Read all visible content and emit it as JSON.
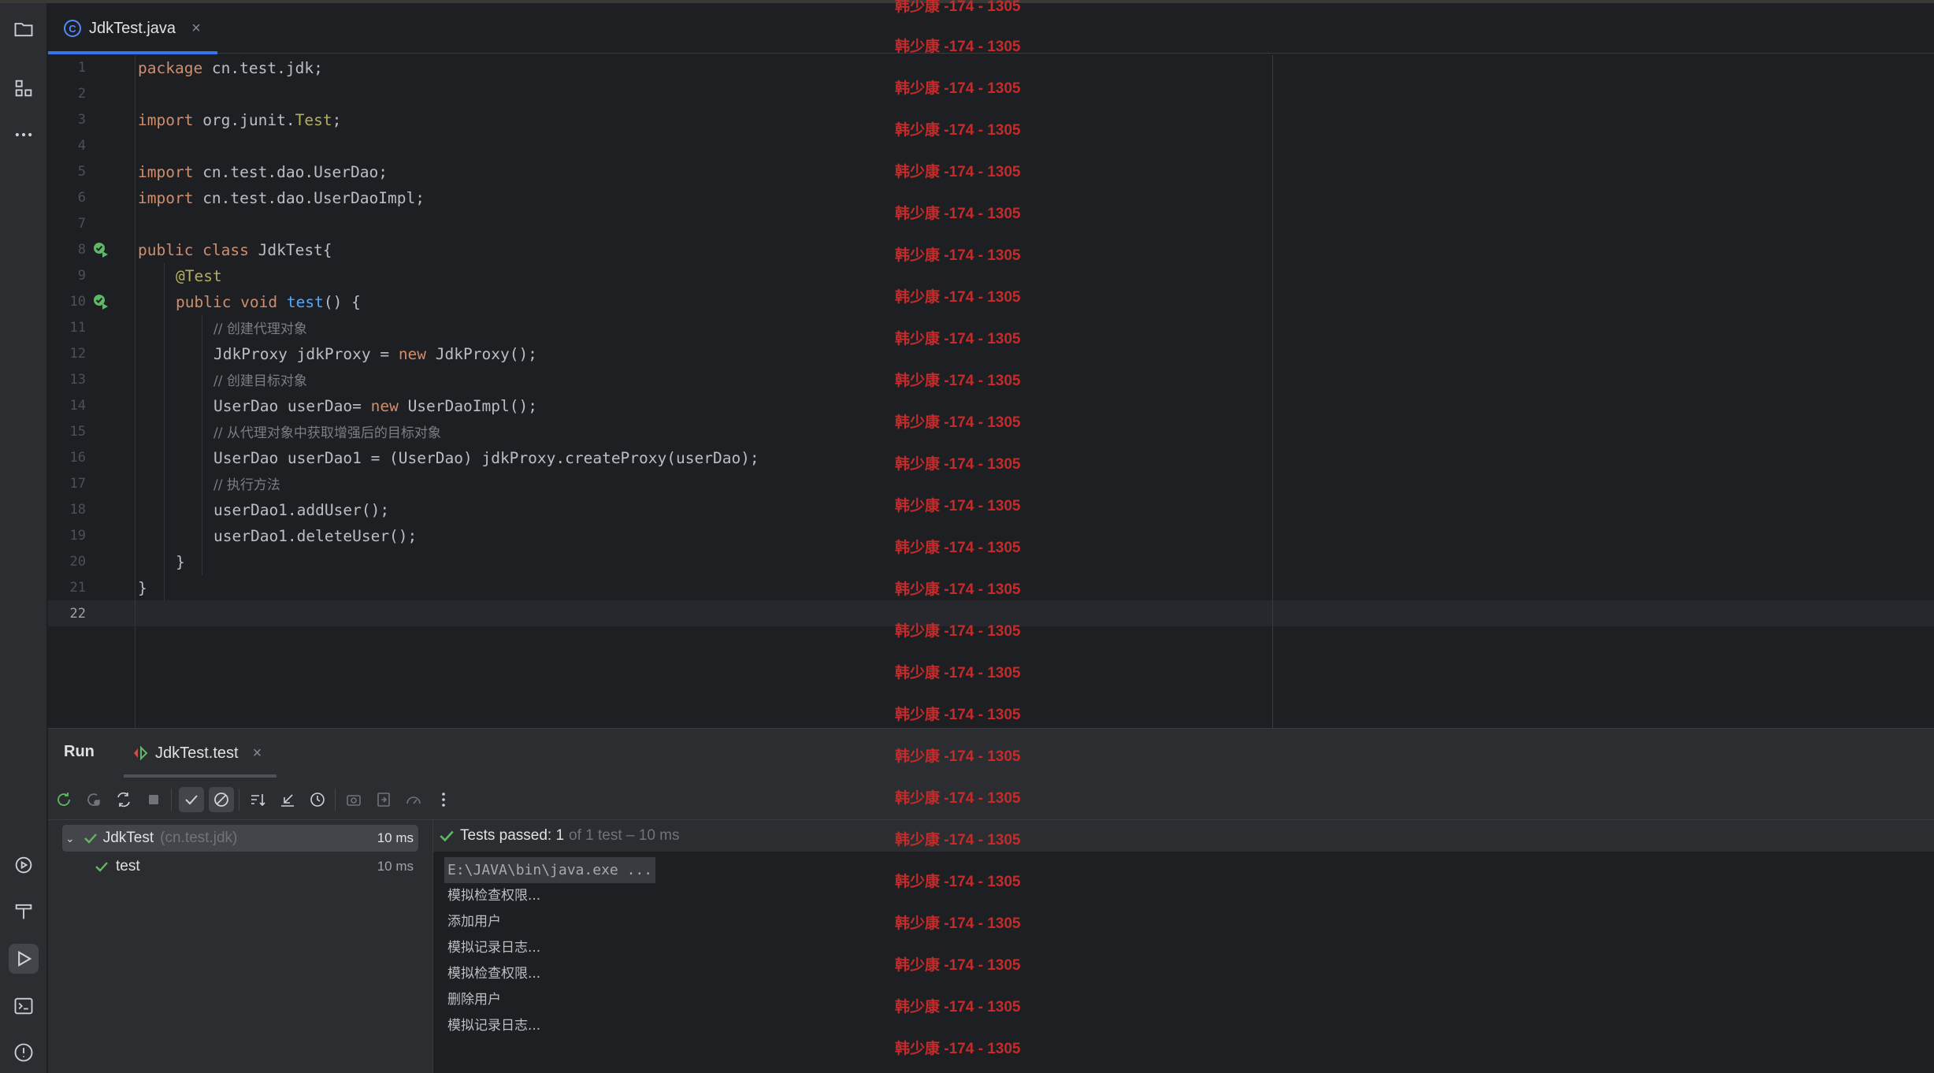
{
  "editor": {
    "tab": {
      "label": "JdkTest.java",
      "icon": "java-class-icon"
    },
    "line_numbers": [
      "1",
      "2",
      "3",
      "4",
      "5",
      "6",
      "7",
      "8",
      "9",
      "10",
      "11",
      "12",
      "13",
      "14",
      "15",
      "16",
      "17",
      "18",
      "19",
      "20",
      "21",
      "22"
    ],
    "code": {
      "l1": [
        "package",
        " cn.test.jdk;"
      ],
      "l3": [
        "import",
        " org.junit.",
        "Test",
        ";"
      ],
      "l5": [
        "import",
        " cn.test.dao.UserDao;"
      ],
      "l6": [
        "import",
        " cn.test.dao.UserDaoImpl;"
      ],
      "l8": [
        "public class",
        " JdkTest{"
      ],
      "l9": [
        "@Test"
      ],
      "l10": [
        "public void",
        " ",
        "test",
        "() {"
      ],
      "l11": [
        "// 创建代理对象"
      ],
      "l12": [
        "JdkProxy jdkProxy = ",
        "new",
        " JdkProxy();"
      ],
      "l13": [
        "// 创建目标对象"
      ],
      "l14": [
        "UserDao userDao= ",
        "new",
        " UserDaoImpl();"
      ],
      "l15": [
        "// 从代理对象中获取增强后的目标对象"
      ],
      "l16": [
        "UserDao userDao1 = (UserDao) jdkProxy.createProxy(userDao);"
      ],
      "l17": [
        "// 执行方法"
      ],
      "l18": [
        "userDao1.addUser();"
      ],
      "l19": [
        "userDao1.deleteUser();"
      ],
      "l20": [
        "}"
      ],
      "l21": [
        "}"
      ]
    }
  },
  "run_panel": {
    "title": "Run",
    "tab_label": "JdkTest.test",
    "tree": [
      {
        "name": "JdkTest",
        "package": "(cn.test.jdk)",
        "duration": "10 ms"
      },
      {
        "name": "test",
        "duration": "10 ms"
      }
    ],
    "status": {
      "strong": "Tests passed: 1",
      "rest": "of 1 test – 10 ms"
    },
    "output": [
      "E:\\JAVA\\bin\\java.exe ...",
      "模拟检查权限...",
      "添加用户",
      "模拟记录日志...",
      "模拟检查权限...",
      "删除用户",
      "模拟记录日志..."
    ]
  },
  "watermark": "韩少康 -174 - 1305",
  "colors": {
    "keyword": "#cf8e6d",
    "annotation": "#b3ae60",
    "function": "#56a8f5",
    "comment": "#7a7e85",
    "accent": "#3574f0",
    "pass": "#5fb865",
    "watermark": "#c42b2b"
  }
}
